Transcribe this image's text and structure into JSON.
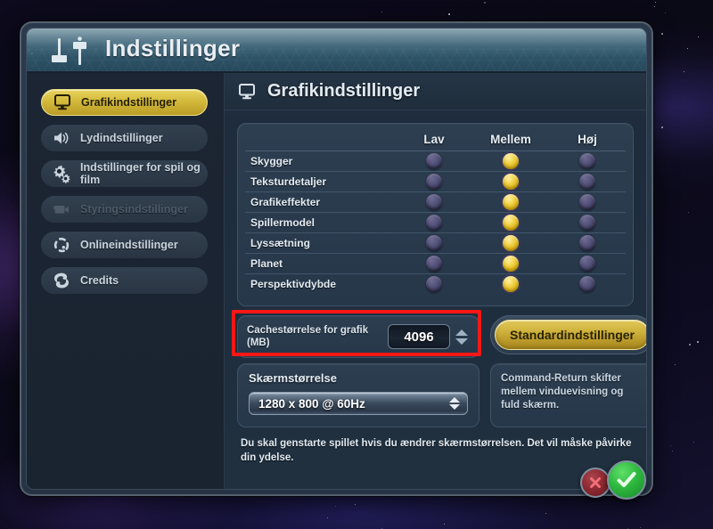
{
  "window": {
    "title": "Indstillinger",
    "title_icon": "sliders-icon"
  },
  "sidebar": {
    "items": [
      {
        "label": "Grafikindstillinger",
        "icon": "monitor-icon",
        "state": "active"
      },
      {
        "label": "Lydindstillinger",
        "icon": "speaker-icon",
        "state": "normal"
      },
      {
        "label": "Indstillinger for spil og film",
        "icon": "gears-icon",
        "state": "normal"
      },
      {
        "label": "Styringsindstillinger",
        "icon": "camera-icon",
        "state": "disabled"
      },
      {
        "label": "Onlineindstillinger",
        "icon": "network-icon",
        "state": "normal"
      },
      {
        "label": "Credits",
        "icon": "spiral-icon",
        "state": "normal"
      }
    ]
  },
  "content": {
    "header": {
      "title": "Grafikindstillinger",
      "icon": "monitor-icon"
    },
    "quality_table": {
      "columns": [
        "Lav",
        "Mellem",
        "Høj"
      ],
      "rows": [
        {
          "label": "Skygger",
          "selected": 1
        },
        {
          "label": "Teksturdetaljer",
          "selected": 1
        },
        {
          "label": "Grafikeffekter",
          "selected": 1
        },
        {
          "label": "Spillermodel",
          "selected": 1
        },
        {
          "label": "Lyssætning",
          "selected": 1
        },
        {
          "label": "Planet",
          "selected": 1
        },
        {
          "label": "Perspektivdybde",
          "selected": 1
        }
      ]
    },
    "cache": {
      "label": "Cachestørrelse for grafik (MB)",
      "value": "4096",
      "stepper_icon": "stepper-up-down-icon",
      "highlight_color": "#fb1715"
    },
    "default_button": {
      "label": "Standardindstillinger"
    },
    "screen_size": {
      "title": "Skærmstørrelse",
      "selected": "1280 x  800 @  60Hz",
      "arrows_icon": "stepper-up-down-icon"
    },
    "hint": "Command-Return skifter mellem vinduevisning og fuld skærm.",
    "note": "Du skal genstarte spillet hvis du ændrer skærmstørrelsen. Det vil måske påvirke din ydelse."
  },
  "footer": {
    "cancel": {
      "icon": "close-x-icon"
    },
    "ok": {
      "icon": "checkmark-icon"
    }
  },
  "colors": {
    "accent_gold": "#d3b93b",
    "radio_on": "#f2d44a",
    "highlight": "#fb1715"
  }
}
